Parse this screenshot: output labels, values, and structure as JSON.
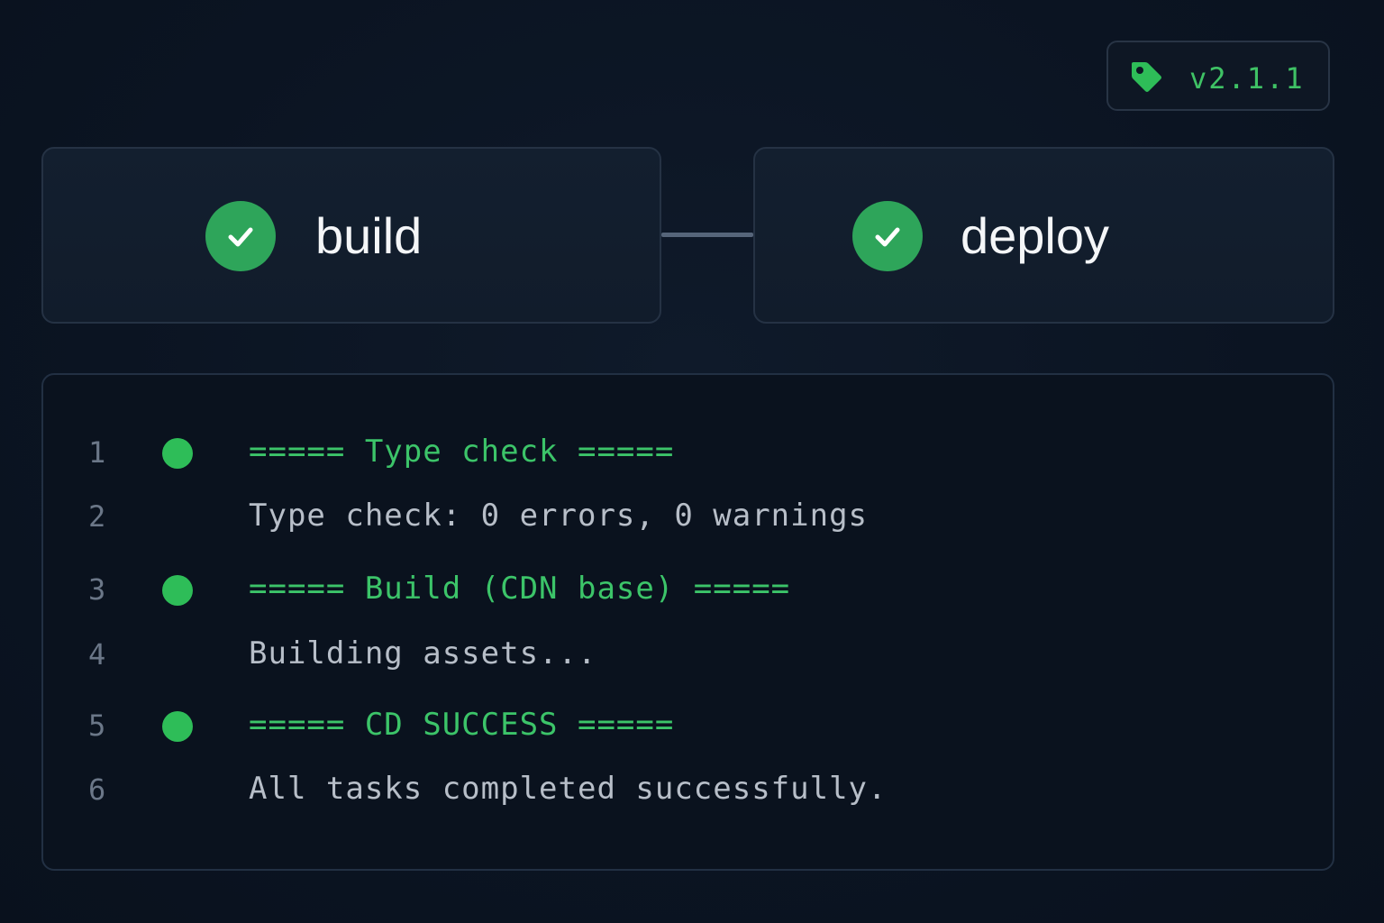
{
  "version_tag": {
    "icon": "tag-icon",
    "label": "v2.1.1"
  },
  "colors": {
    "background": "#0b1422",
    "success_green": "#2ea55a",
    "heading_green": "#3cc469",
    "plain_text": "#b7bec8",
    "line_number": "#6b7788"
  },
  "pipeline": {
    "jobs": [
      {
        "name": "build",
        "status": "success",
        "icon": "check-circle-icon"
      },
      {
        "name": "deploy",
        "status": "success",
        "icon": "check-circle-icon"
      }
    ]
  },
  "log": {
    "lines": [
      {
        "number": "1",
        "type": "heading",
        "has_dot": true,
        "text": "===== Type check ====="
      },
      {
        "number": "2",
        "type": "plain",
        "has_dot": false,
        "text": "Type check: 0 errors, 0 warnings"
      },
      {
        "number": "3",
        "type": "heading",
        "has_dot": true,
        "text": "===== Build (CDN base) ====="
      },
      {
        "number": "4",
        "type": "plain",
        "has_dot": false,
        "text": "Building assets..."
      },
      {
        "number": "5",
        "type": "heading",
        "has_dot": true,
        "text": "===== CD SUCCESS ====="
      },
      {
        "number": "6",
        "type": "plain",
        "has_dot": false,
        "text": "All tasks completed successfully."
      }
    ]
  }
}
